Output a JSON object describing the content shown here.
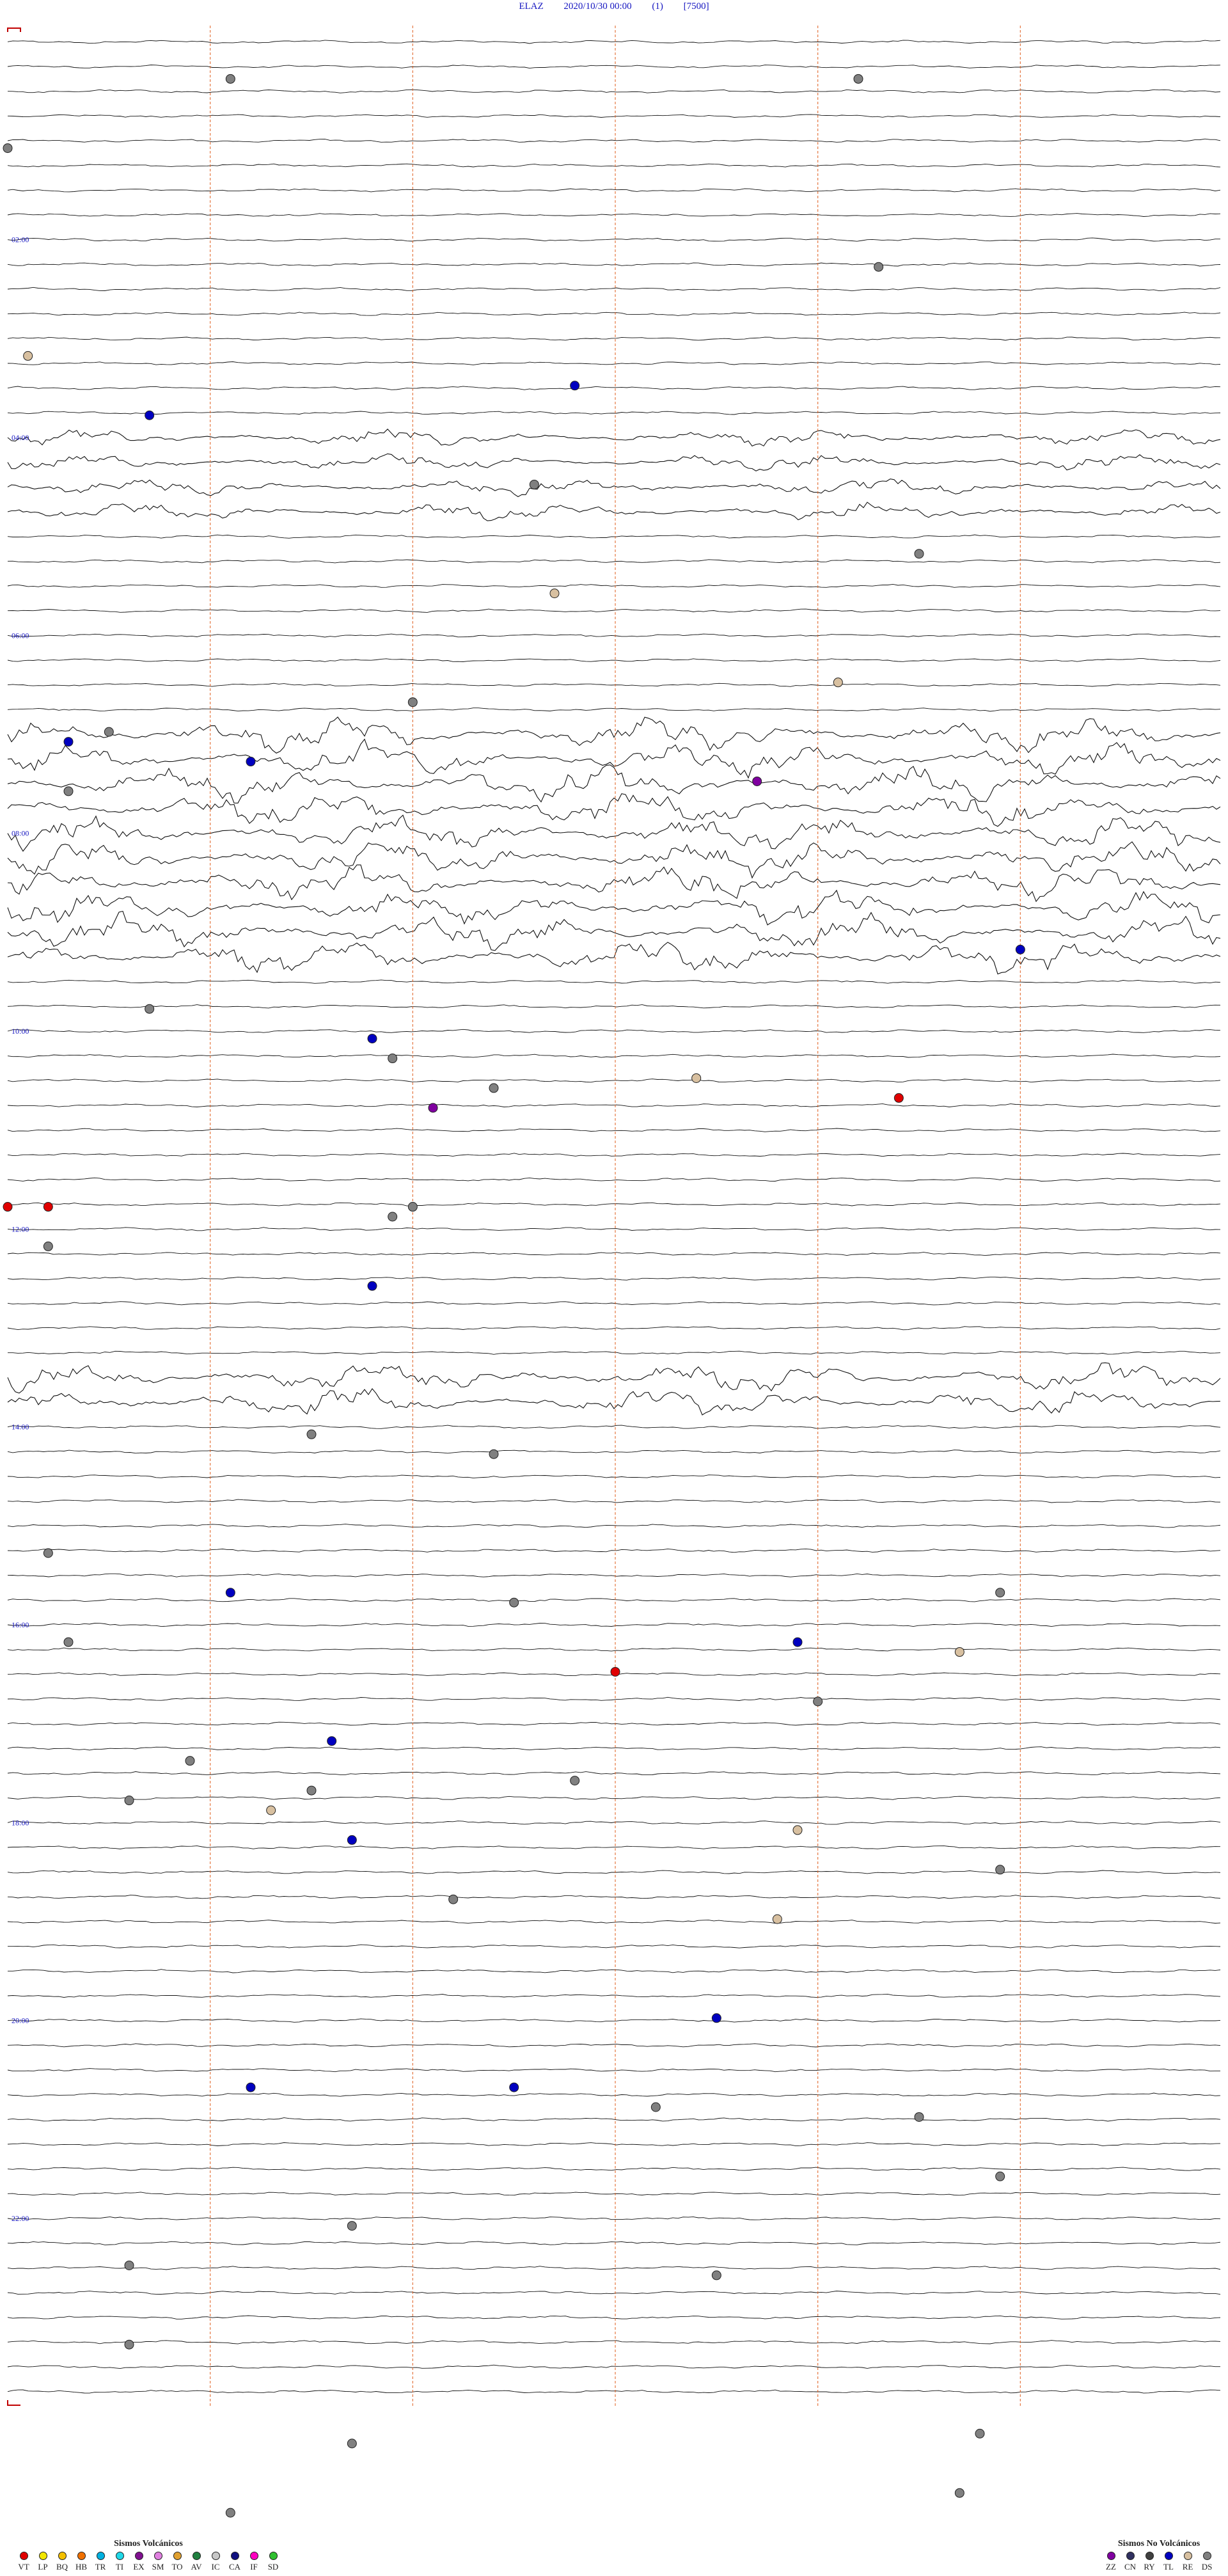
{
  "header": {
    "station": "ELAZ",
    "datetime": "2020/10/30 00:00",
    "channel": "(1)",
    "scale": "[7500]"
  },
  "chart_data": {
    "type": "helicorder",
    "start": "2020/10/30 00:00",
    "hour_labels": [
      {
        "hour": 2,
        "text": "02:00"
      },
      {
        "hour": 4,
        "text": "04:00"
      },
      {
        "hour": 6,
        "text": "06:00"
      },
      {
        "hour": 8,
        "text": "08:00"
      },
      {
        "hour": 10,
        "text": "10:00"
      },
      {
        "hour": 12,
        "text": "12:00"
      },
      {
        "hour": 14,
        "text": "14:00"
      },
      {
        "hour": 16,
        "text": "16:00"
      },
      {
        "hour": 18,
        "text": "18:00"
      },
      {
        "hour": 20,
        "text": "20:00"
      },
      {
        "hour": 22,
        "text": "22:00"
      }
    ],
    "minute_marks": [
      10,
      20,
      30,
      40,
      50
    ],
    "events": [
      {
        "hour": 0.5,
        "minute": 11,
        "class": "DS"
      },
      {
        "hour": 0.5,
        "minute": 42,
        "class": "DS"
      },
      {
        "hour": 1.2,
        "minute": 0,
        "class": "DS"
      },
      {
        "hour": 2.4,
        "minute": 43,
        "class": "DS"
      },
      {
        "hour": 3.3,
        "minute": 1,
        "class": "RE"
      },
      {
        "hour": 3.6,
        "minute": 28,
        "class": "TL"
      },
      {
        "hour": 3.9,
        "minute": 7,
        "class": "TL"
      },
      {
        "hour": 4.6,
        "minute": 26,
        "class": "DS"
      },
      {
        "hour": 5.3,
        "minute": 45,
        "class": "DS"
      },
      {
        "hour": 5.7,
        "minute": 27,
        "class": "RE"
      },
      {
        "hour": 6.6,
        "minute": 41,
        "class": "RE"
      },
      {
        "hour": 6.8,
        "minute": 20,
        "class": "DS"
      },
      {
        "hour": 7.1,
        "minute": 5,
        "class": "DS"
      },
      {
        "hour": 7.2,
        "minute": 3,
        "class": "TL"
      },
      {
        "hour": 7.4,
        "minute": 12,
        "class": "TL"
      },
      {
        "hour": 7.6,
        "minute": 37,
        "class": "ZZ"
      },
      {
        "hour": 7.7,
        "minute": 3,
        "class": "DS"
      },
      {
        "hour": 9.3,
        "minute": 50,
        "class": "TL"
      },
      {
        "hour": 9.9,
        "minute": 7,
        "class": "DS"
      },
      {
        "hour": 10.2,
        "minute": 18,
        "class": "TL"
      },
      {
        "hour": 10.4,
        "minute": 19,
        "class": "DS"
      },
      {
        "hour": 10.6,
        "minute": 34,
        "class": "RE"
      },
      {
        "hour": 10.7,
        "minute": 24,
        "class": "DS"
      },
      {
        "hour": 10.8,
        "minute": 44,
        "class": "VT"
      },
      {
        "hour": 10.9,
        "minute": 21,
        "class": "ZZ"
      },
      {
        "hour": 11.9,
        "minute": 0,
        "class": "VT"
      },
      {
        "hour": 11.9,
        "minute": 2,
        "class": "VT"
      },
      {
        "hour": 11.9,
        "minute": 20,
        "class": "DS"
      },
      {
        "hour": 12.0,
        "minute": 19,
        "class": "DS"
      },
      {
        "hour": 12.3,
        "minute": 2,
        "class": "DS"
      },
      {
        "hour": 12.7,
        "minute": 18,
        "class": "TL"
      },
      {
        "hour": 14.2,
        "minute": 15,
        "class": "DS"
      },
      {
        "hour": 14.4,
        "minute": 24,
        "class": "DS"
      },
      {
        "hour": 15.4,
        "minute": 2,
        "class": "DS"
      },
      {
        "hour": 15.8,
        "minute": 11,
        "class": "TL"
      },
      {
        "hour": 15.9,
        "minute": 25,
        "class": "DS"
      },
      {
        "hour": 15.8,
        "minute": 49,
        "class": "DS"
      },
      {
        "hour": 16.3,
        "minute": 3,
        "class": "DS"
      },
      {
        "hour": 16.3,
        "minute": 39,
        "class": "TL"
      },
      {
        "hour": 16.4,
        "minute": 47,
        "class": "RE"
      },
      {
        "hour": 16.6,
        "minute": 30,
        "class": "VT"
      },
      {
        "hour": 16.9,
        "minute": 40,
        "class": "DS"
      },
      {
        "hour": 17.3,
        "minute": 16,
        "class": "TL"
      },
      {
        "hour": 17.5,
        "minute": 9,
        "class": "DS"
      },
      {
        "hour": 17.7,
        "minute": 28,
        "class": "DS"
      },
      {
        "hour": 17.8,
        "minute": 15,
        "class": "DS"
      },
      {
        "hour": 17.9,
        "minute": 6,
        "class": "DS"
      },
      {
        "hour": 18.0,
        "minute": 13,
        "class": "RE"
      },
      {
        "hour": 18.2,
        "minute": 39,
        "class": "RE"
      },
      {
        "hour": 18.3,
        "minute": 17,
        "class": "TL"
      },
      {
        "hour": 18.6,
        "minute": 49,
        "class": "DS"
      },
      {
        "hour": 18.9,
        "minute": 22,
        "class": "DS"
      },
      {
        "hour": 19.1,
        "minute": 38,
        "class": "RE"
      },
      {
        "hour": 20.1,
        "minute": 35,
        "class": "TL"
      },
      {
        "hour": 20.8,
        "minute": 12,
        "class": "TL"
      },
      {
        "hour": 20.8,
        "minute": 25,
        "class": "TL"
      },
      {
        "hour": 21.0,
        "minute": 32,
        "class": "DS"
      },
      {
        "hour": 21.1,
        "minute": 45,
        "class": "DS"
      },
      {
        "hour": 21.7,
        "minute": 49,
        "class": "DS"
      },
      {
        "hour": 22.2,
        "minute": 17,
        "class": "DS"
      },
      {
        "hour": 22.6,
        "minute": 6,
        "class": "DS"
      },
      {
        "hour": 22.7,
        "minute": 35,
        "class": "DS"
      },
      {
        "hour": 23.4,
        "minute": 6,
        "class": "DS"
      },
      {
        "hour": 24.4,
        "minute": 17,
        "class": "DS"
      },
      {
        "hour": 24.3,
        "minute": 48,
        "class": "DS"
      },
      {
        "hour": 24.9,
        "minute": 47,
        "class": "DS"
      },
      {
        "hour": 25.1,
        "minute": 11,
        "class": "DS"
      }
    ],
    "noisy_periods": [
      {
        "start_hour": 4.0,
        "end_hour": 4.8,
        "amplitude": 3
      },
      {
        "start_hour": 7.0,
        "end_hour": 9.3,
        "amplitude": 6
      },
      {
        "start_hour": 13.3,
        "end_hour": 13.9,
        "amplitude": 5
      }
    ]
  },
  "legend": {
    "volcanic_title": "Sismos Volcánicos",
    "volcanic": [
      {
        "code": "VT",
        "color": "#e00000"
      },
      {
        "code": "LP",
        "color": "#f2e600"
      },
      {
        "code": "BQ",
        "color": "#f4c000"
      },
      {
        "code": "HB",
        "color": "#f07000"
      },
      {
        "code": "TR",
        "color": "#00b0e0"
      },
      {
        "code": "TI",
        "color": "#20d8e8"
      },
      {
        "code": "EX",
        "color": "#801090"
      },
      {
        "code": "SM",
        "color": "#e080e0"
      },
      {
        "code": "TO",
        "color": "#e0a030"
      },
      {
        "code": "AV",
        "color": "#208040"
      },
      {
        "code": "IC",
        "color": "#c8c8c8"
      },
      {
        "code": "CA",
        "color": "#101080"
      },
      {
        "code": "IF",
        "color": "#ff00c0"
      },
      {
        "code": "SD",
        "color": "#30c030"
      }
    ],
    "nonvolcanic_title": "Sismos No Volcánicos",
    "nonvolcanic": [
      {
        "code": "ZZ",
        "color": "#8000a0"
      },
      {
        "code": "CN",
        "color": "#303060"
      },
      {
        "code": "RY",
        "color": "#404040"
      },
      {
        "code": "TL",
        "color": "#0000c0"
      },
      {
        "code": "RE",
        "color": "#d8c0a0"
      },
      {
        "code": "DS",
        "color": "#808080"
      }
    ]
  }
}
